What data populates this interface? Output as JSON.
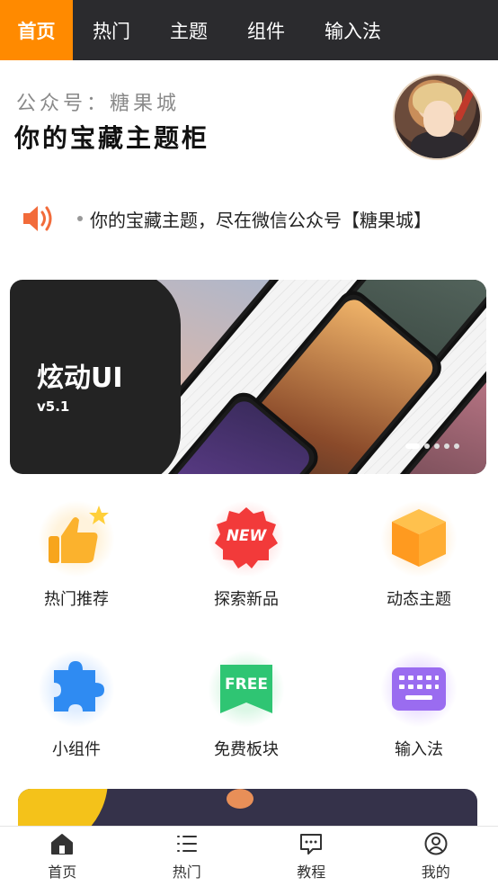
{
  "top_nav": {
    "tabs": [
      {
        "label": "首页",
        "active": true
      },
      {
        "label": "热门",
        "active": false
      },
      {
        "label": "主题",
        "active": false
      },
      {
        "label": "组件",
        "active": false
      },
      {
        "label": "输入法",
        "active": false
      }
    ]
  },
  "header": {
    "subtitle": "公众号：糖果城",
    "title": "你的宝藏主题柜"
  },
  "notice": {
    "text": "你的宝藏主题，尽在微信公众号【糖果城】"
  },
  "banner": {
    "title": "炫动UI",
    "version": "v5.1",
    "slide_count": 5,
    "active_slide": 1
  },
  "grid": [
    {
      "label": "热门推荐",
      "icon": "thumbs-up-icon"
    },
    {
      "label": "探索新品",
      "icon": "new-badge-icon",
      "badge_text": "NEW"
    },
    {
      "label": "动态主题",
      "icon": "cube-icon"
    },
    {
      "label": "小组件",
      "icon": "puzzle-icon"
    },
    {
      "label": "免费板块",
      "icon": "free-tag-icon",
      "badge_text": "FREE"
    },
    {
      "label": "输入法",
      "icon": "keyboard-icon"
    }
  ],
  "bottom_nav": [
    {
      "label": "首页",
      "icon": "home-icon",
      "active": true
    },
    {
      "label": "热门",
      "icon": "list-icon",
      "active": false
    },
    {
      "label": "教程",
      "icon": "chat-icon",
      "active": false
    },
    {
      "label": "我的",
      "icon": "profile-icon",
      "active": false
    }
  ],
  "colors": {
    "accent": "#ff8a00",
    "topnav_bg": "#2b2b2e",
    "speaker": "#f26b3a"
  }
}
